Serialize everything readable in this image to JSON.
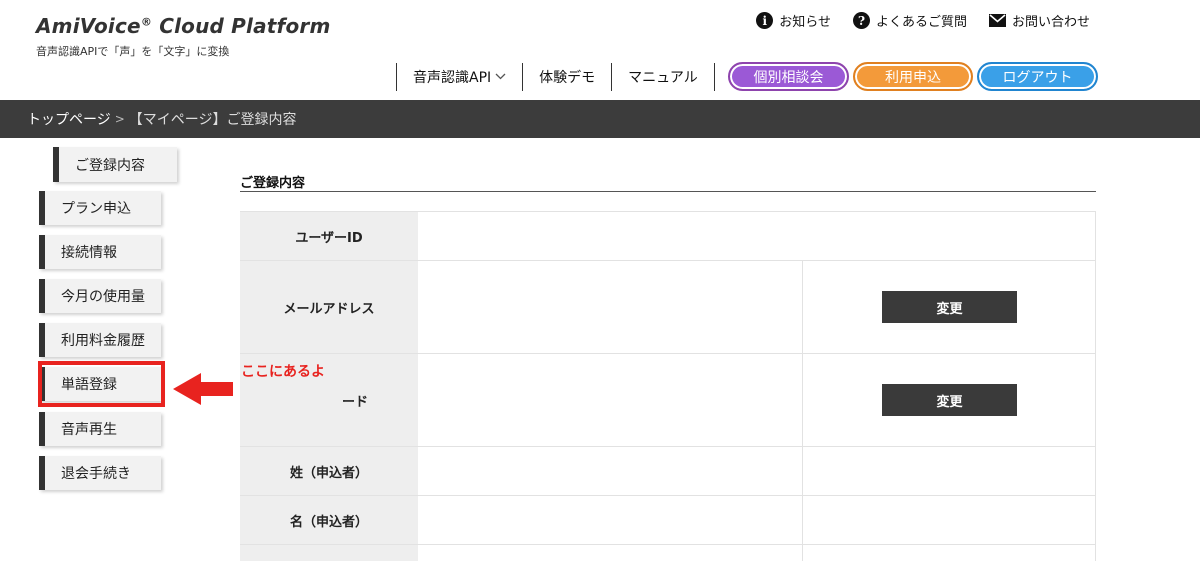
{
  "header": {
    "brand_name": "AmiVoice",
    "brand_reg": "®",
    "brand_rest": " Cloud Platform",
    "brand_sub": "音声認識APIで「声」を「文字」に変換"
  },
  "utility_nav": [
    {
      "icon": "info-icon",
      "glyph": "i",
      "label": "お知らせ"
    },
    {
      "icon": "question-icon",
      "glyph": "?",
      "label": "よくあるご質問"
    },
    {
      "icon": "mail-icon",
      "label": "お問い合わせ"
    }
  ],
  "main_nav": {
    "speech_api": "音声認識API",
    "demo": "体験デモ",
    "manual": "マニュアル"
  },
  "pills": {
    "consult": "個別相談会",
    "apply": "利用申込",
    "logout": "ログアウト"
  },
  "breadcrumb": {
    "home": "トップページ",
    "sep": ">",
    "current": "【マイページ】ご登録内容"
  },
  "sidebar": [
    "ご登録内容",
    "プラン申込",
    "接続情報",
    "今月の使用量",
    "利用料金履歴",
    "単語登録",
    "音声再生",
    "退会手続き"
  ],
  "annotation": {
    "text": "ここにあるよ",
    "color": "#e8231f"
  },
  "section_title": "ご登録内容",
  "table": {
    "user_id": "ユーザーID",
    "email": "メールアドレス",
    "password_partial": "ード",
    "last_name": "姓（申込者）",
    "first_name": "名（申込者）",
    "change": "変更"
  },
  "colors": {
    "consult": "#9b59d6",
    "apply": "#f39a3a",
    "logout": "#3aa0e8",
    "breadcrumb_bg": "#3c3c3c",
    "button_dark": "#3a3a3a"
  }
}
